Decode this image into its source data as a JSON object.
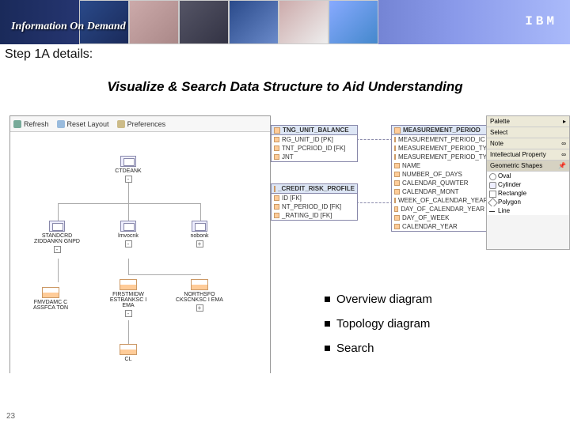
{
  "banner": {
    "title": "Information On Demand",
    "logo": "IBM"
  },
  "step": "Step 1A details:",
  "subtitle": "Visualize & Search Data Structure to Aid Understanding",
  "toolbar": {
    "refresh": "Refresh",
    "reset": "Reset Layout",
    "prefs": "Preferences"
  },
  "tree": {
    "n0": "CTDEANK",
    "n1": "STANDCRD ZIDDANKN GNPD",
    "n2": "lmvocnk",
    "n3": "nobonk",
    "n4": "FIRSTMIDW ESTBANKSC I EMA",
    "n5": "NORTHSFO CKSCNKSC I EMA",
    "n6": "FMVDAMC C ASSFCA TON",
    "n7": "CL"
  },
  "entities": {
    "e1_hdr": "TNG_UNIT_BALANCE",
    "e1_r1": "RG_UNIT_ID [PK]",
    "e1_r2": "TNT_PCRIOD_ID [FK]",
    "e1_r3": "JNT",
    "e2_hdr": "_CREDIT_RISK_PROFILE",
    "e2_r1": "ID [FK]",
    "e2_r2": "NT_PERIOD_ID [FK]",
    "e2_r3": "_RATING_ID [FK]",
    "e3_hdr": "MEASUREMENT_PERIOD",
    "e3_r1": "MEASUREMENT_PERIOD_IC",
    "e3_r2": "MEASUREMENT_PERIOD_TYPE",
    "e3_r3": "MEASUREMENT_PERIOD_TYPE",
    "e3_r4": "NAME",
    "e3_r5": "NUMBER_OF_DAYS",
    "e3_r6": "CALENDAR_QUWTER",
    "e3_r7": "CALENDAR_MONT",
    "e3_r8": "WEEK_OF_CALENDAR_YEAR",
    "e3_r9": "DAY_OF_CALENDAR_YEAR",
    "e3_r10": "DAY_OF_WEEK",
    "e3_r11": "CALENDAR_YEAR"
  },
  "palette": {
    "title": "Palette",
    "s1": "Select",
    "s2": "Note",
    "s3": "Intellectual Property",
    "s4": "Geometric Shapes",
    "oval": "Oval",
    "cyl": "Cylinder",
    "rect": "Rectangle",
    "poly": "Polygon",
    "line": "Line"
  },
  "bullets": {
    "b1": "Overview diagram",
    "b2": "Topology diagram",
    "b3": "Search"
  },
  "page": "23"
}
